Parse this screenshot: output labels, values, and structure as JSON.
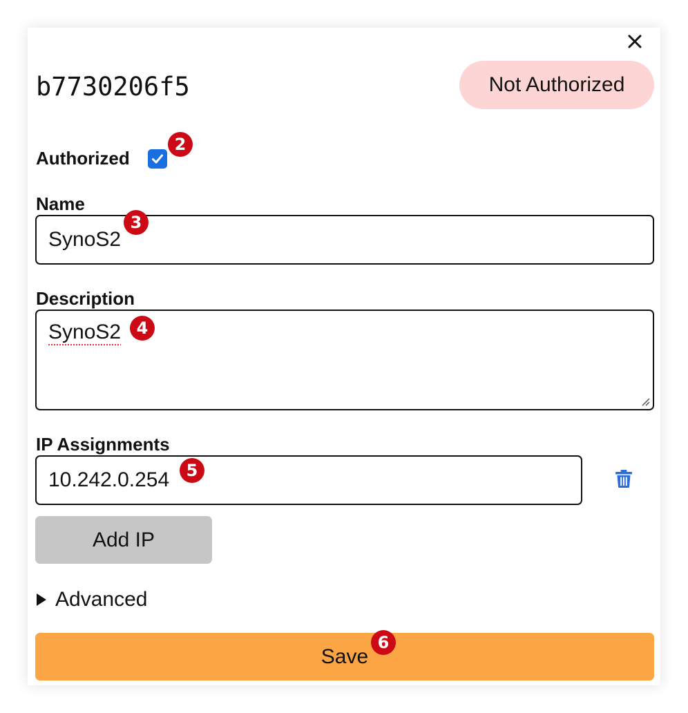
{
  "header": {
    "node_id": "b7730206f5",
    "status": "Not Authorized"
  },
  "authorized": {
    "label": "Authorized",
    "checked": true
  },
  "name": {
    "label": "Name",
    "value": "SynoS2"
  },
  "description": {
    "label": "Description",
    "value": "SynoS2"
  },
  "ip_assignments": {
    "label": "IP Assignments",
    "items": [
      "10.242.0.254"
    ],
    "add_label": "Add IP"
  },
  "advanced": {
    "label": "Advanced"
  },
  "save_label": "Save",
  "badges": [
    "2",
    "3",
    "4",
    "5",
    "6"
  ],
  "icons": {
    "close": "close-icon",
    "checkbox": "checkmark-icon",
    "trash": "trash-icon",
    "advanced": "triangle-right-icon"
  },
  "colors": {
    "status_bg": "#fdd5d5",
    "checkbox": "#1a6fe0",
    "badge": "#cc0a16",
    "trash": "#2b6fd6",
    "add_ip_bg": "#c6c6c6",
    "save_bg": "#fca544"
  }
}
